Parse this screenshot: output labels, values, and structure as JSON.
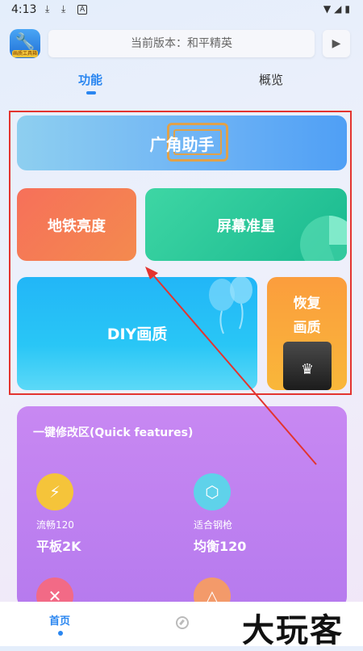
{
  "status_bar": {
    "time": "4:13",
    "left_icons": [
      "download-icon",
      "download-icon",
      "app-notification-icon"
    ],
    "notif_glyph": "A",
    "right_icons": [
      "wifi-icon",
      "signal-icon",
      "battery-icon"
    ]
  },
  "header": {
    "app_badge_text": "画质工具箱",
    "version_text": "当前版本：和平精英"
  },
  "tabs": [
    {
      "label": "功能",
      "active": true
    },
    {
      "label": "概览",
      "active": false
    }
  ],
  "colors": {
    "accent": "#2a86f0",
    "highlight": "#e3342f",
    "quick_panel": "#bf82f1"
  },
  "feature_cards": {
    "wide_angle": "广角助手",
    "subway_brightness": "地铁亮度",
    "screen_crosshair": "屏幕准星",
    "diy_quality": "DIY画质",
    "restore_line1": "恢复",
    "restore_line2": "画质"
  },
  "quick_features": {
    "title": "一键修改区(Quick features)",
    "items": [
      {
        "label": "流畅120",
        "value": "平板2K",
        "icon": "lightning-shield-icon",
        "color": "#f5c43a"
      },
      {
        "label": "适合钢枪",
        "value": "均衡120",
        "icon": "hexagon-icon",
        "color": "#5fd2ea"
      },
      {
        "label": "",
        "value": "",
        "icon": "cross-icon",
        "color": "#f26a86"
      },
      {
        "label": "",
        "value": "",
        "icon": "triangle-icon",
        "color": "#f39a6a"
      }
    ]
  },
  "bottom_nav": {
    "home_label": "首页",
    "compass_icon": "compass-icon"
  },
  "watermark": "大玩客"
}
